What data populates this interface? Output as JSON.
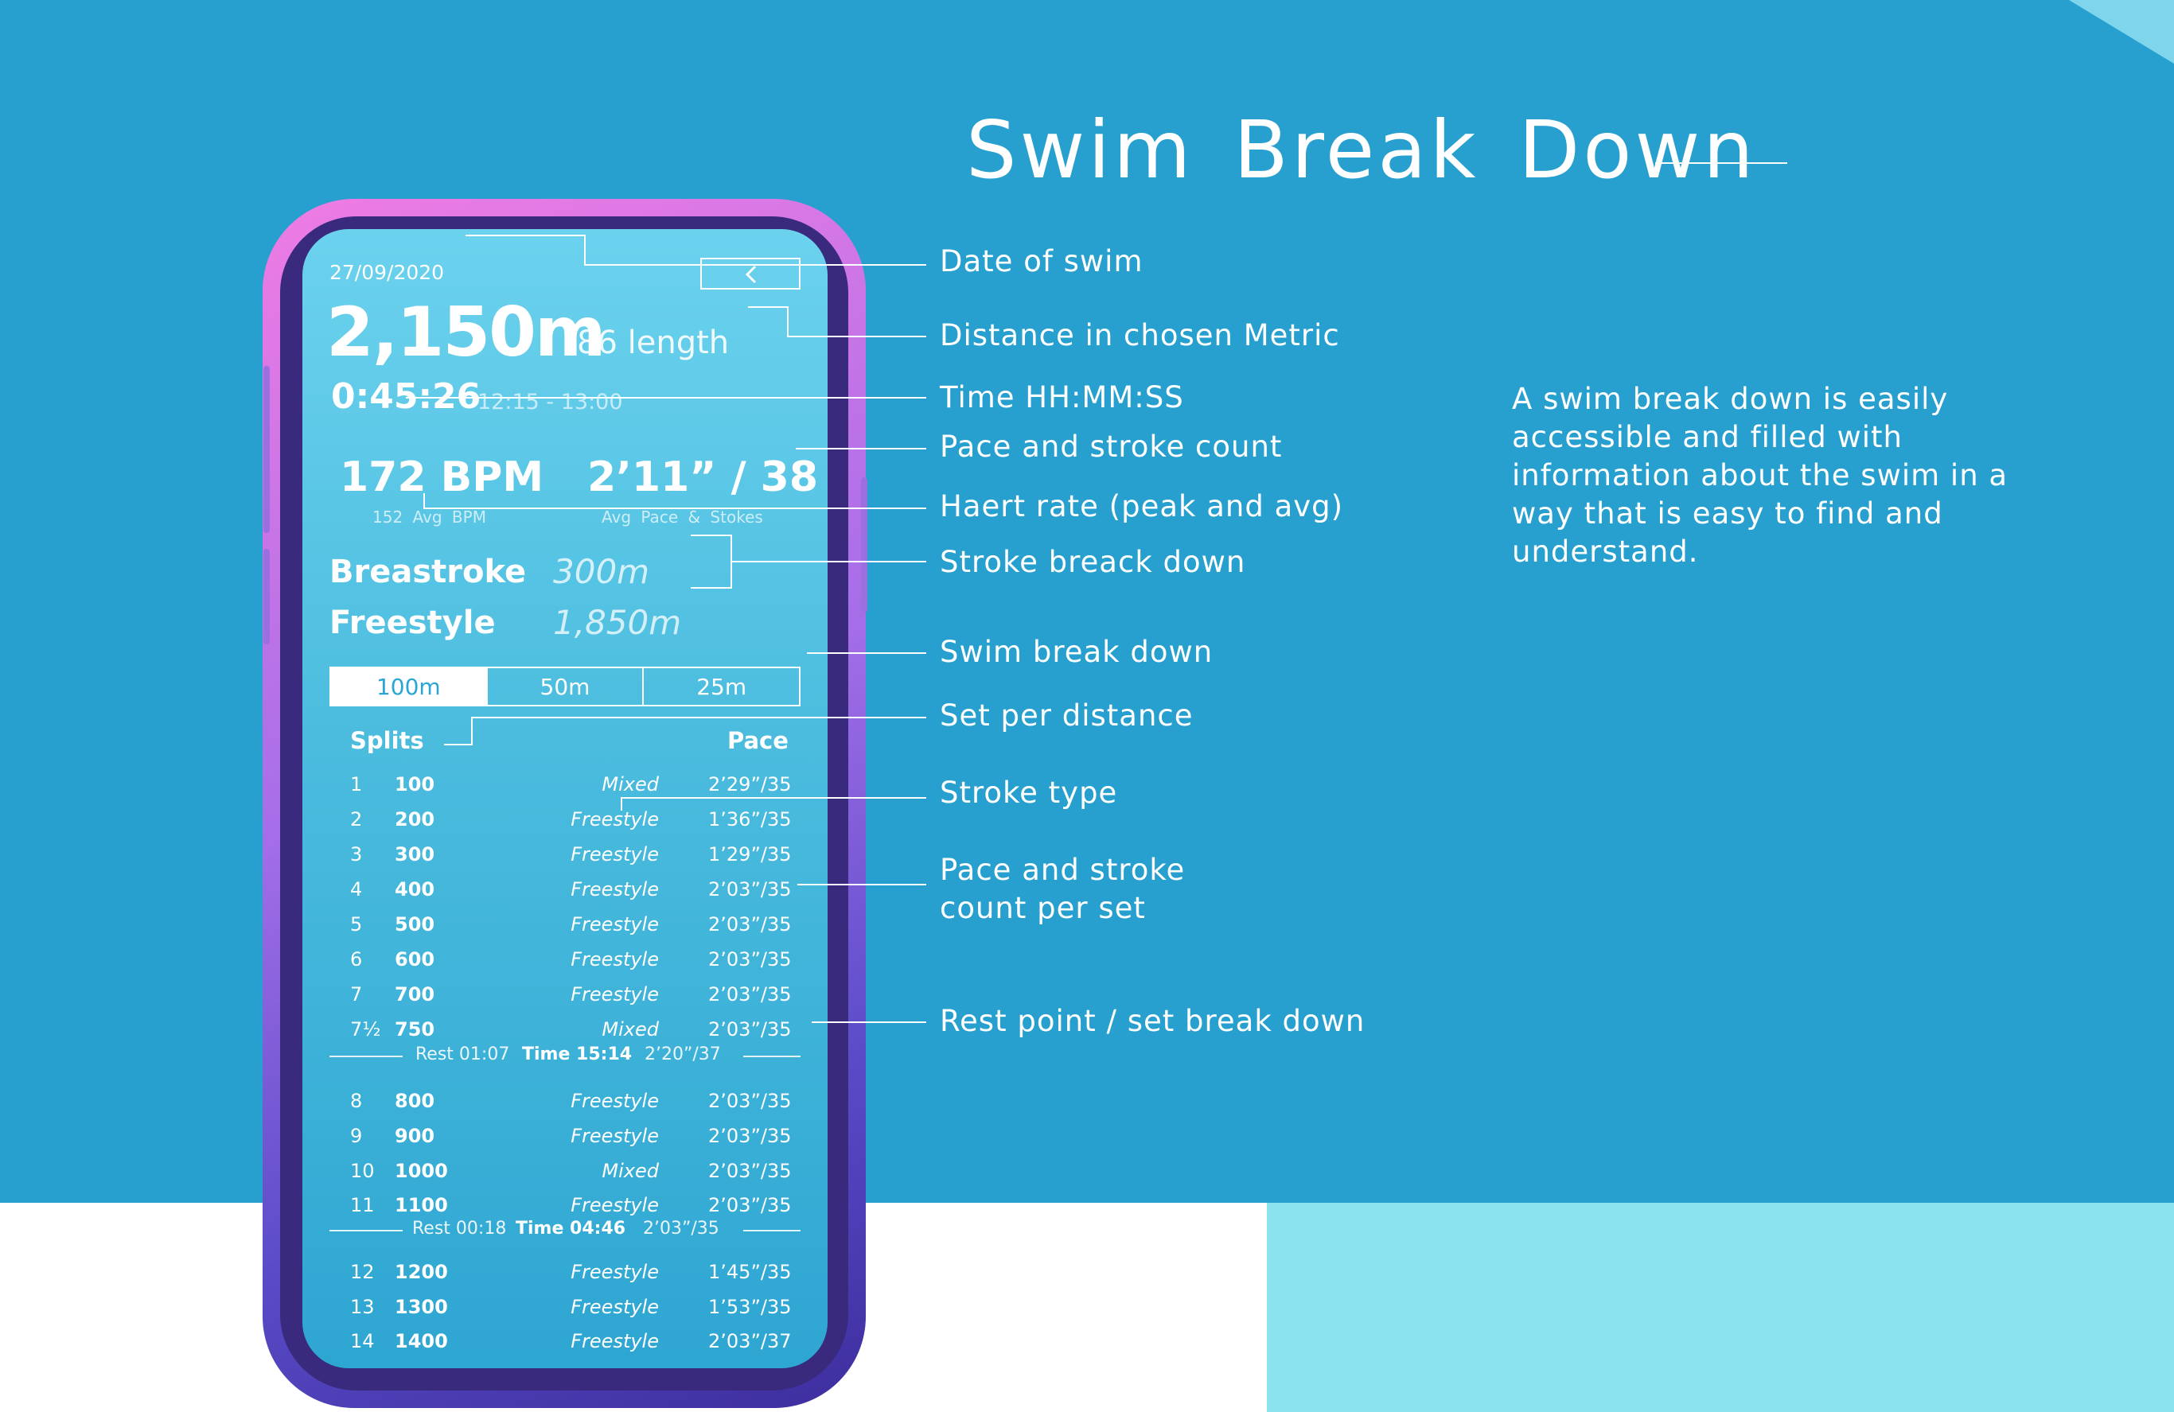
{
  "page": {
    "title": "Swim Break Down"
  },
  "description": "A swim break down is easily accessible and filled with information about the swim in a way that is easy to find and understand.",
  "annotations": [
    "Date of swim",
    "Distance in chosen Metric",
    "Time HH:MM:SS",
    "Pace and stroke count",
    "Haert rate (peak and avg)",
    "Stroke breack down",
    "Swim break down",
    "Set per distance",
    "Stroke type",
    "Pace and stroke",
    "count per set",
    "Rest point / set break down"
  ],
  "summary": {
    "date": "27/09/2020",
    "distance": "2,150m",
    "lengths": "86 length",
    "duration": "0:45:26",
    "time_range": "12:15 - 13:00",
    "bpm": "172 BPM",
    "bpm_sub": "152 Avg BPM",
    "pace": "2’11” / 38",
    "pace_sub": "Avg Pace & Stokes"
  },
  "strokes": [
    {
      "name": "Breastroke",
      "distance": "300m"
    },
    {
      "name": "Freestyle",
      "distance": "1,850m"
    }
  ],
  "tabs": [
    {
      "label": "100m",
      "active": true
    },
    {
      "label": "50m",
      "active": false
    },
    {
      "label": "25m",
      "active": false
    }
  ],
  "splits_header": {
    "splits": "Splits",
    "pace": "Pace"
  },
  "splits": [
    {
      "idx": "1",
      "dist": "100",
      "stroke": "Mixed",
      "pace": "2’29”/35"
    },
    {
      "idx": "2",
      "dist": "200",
      "stroke": "Freestyle",
      "pace": "1’36”/35"
    },
    {
      "idx": "3",
      "dist": "300",
      "stroke": "Freestyle",
      "pace": "1’29”/35"
    },
    {
      "idx": "4",
      "dist": "400",
      "stroke": "Freestyle",
      "pace": "2’03”/35"
    },
    {
      "idx": "5",
      "dist": "500",
      "stroke": "Freestyle",
      "pace": "2’03”/35"
    },
    {
      "idx": "6",
      "dist": "600",
      "stroke": "Freestyle",
      "pace": "2’03”/35"
    },
    {
      "idx": "7",
      "dist": "700",
      "stroke": "Freestyle",
      "pace": "2’03”/35"
    },
    {
      "idx": "7½",
      "dist": "750",
      "stroke": "Mixed",
      "pace": "2’03”/35"
    },
    {
      "idx": "8",
      "dist": "800",
      "stroke": "Freestyle",
      "pace": "2’03”/35"
    },
    {
      "idx": "9",
      "dist": "900",
      "stroke": "Freestyle",
      "pace": "2’03”/35"
    },
    {
      "idx": "10",
      "dist": "1000",
      "stroke": "Mixed",
      "pace": "2’03”/35"
    },
    {
      "idx": "11",
      "dist": "1100",
      "stroke": "Freestyle",
      "pace": "2’03”/35"
    },
    {
      "idx": "12",
      "dist": "1200",
      "stroke": "Freestyle",
      "pace": "1’45”/35"
    },
    {
      "idx": "13",
      "dist": "1300",
      "stroke": "Freestyle",
      "pace": "1’53”/35"
    },
    {
      "idx": "14",
      "dist": "1400",
      "stroke": "Freestyle",
      "pace": "2’03”/37"
    }
  ],
  "rests": [
    {
      "rest": "Rest 01:07",
      "time": "Time 15:14",
      "pace": "2’20”/37"
    },
    {
      "rest": "Rest 00:18",
      "time": "Time 04:46",
      "pace": "2’03”/35"
    }
  ]
}
